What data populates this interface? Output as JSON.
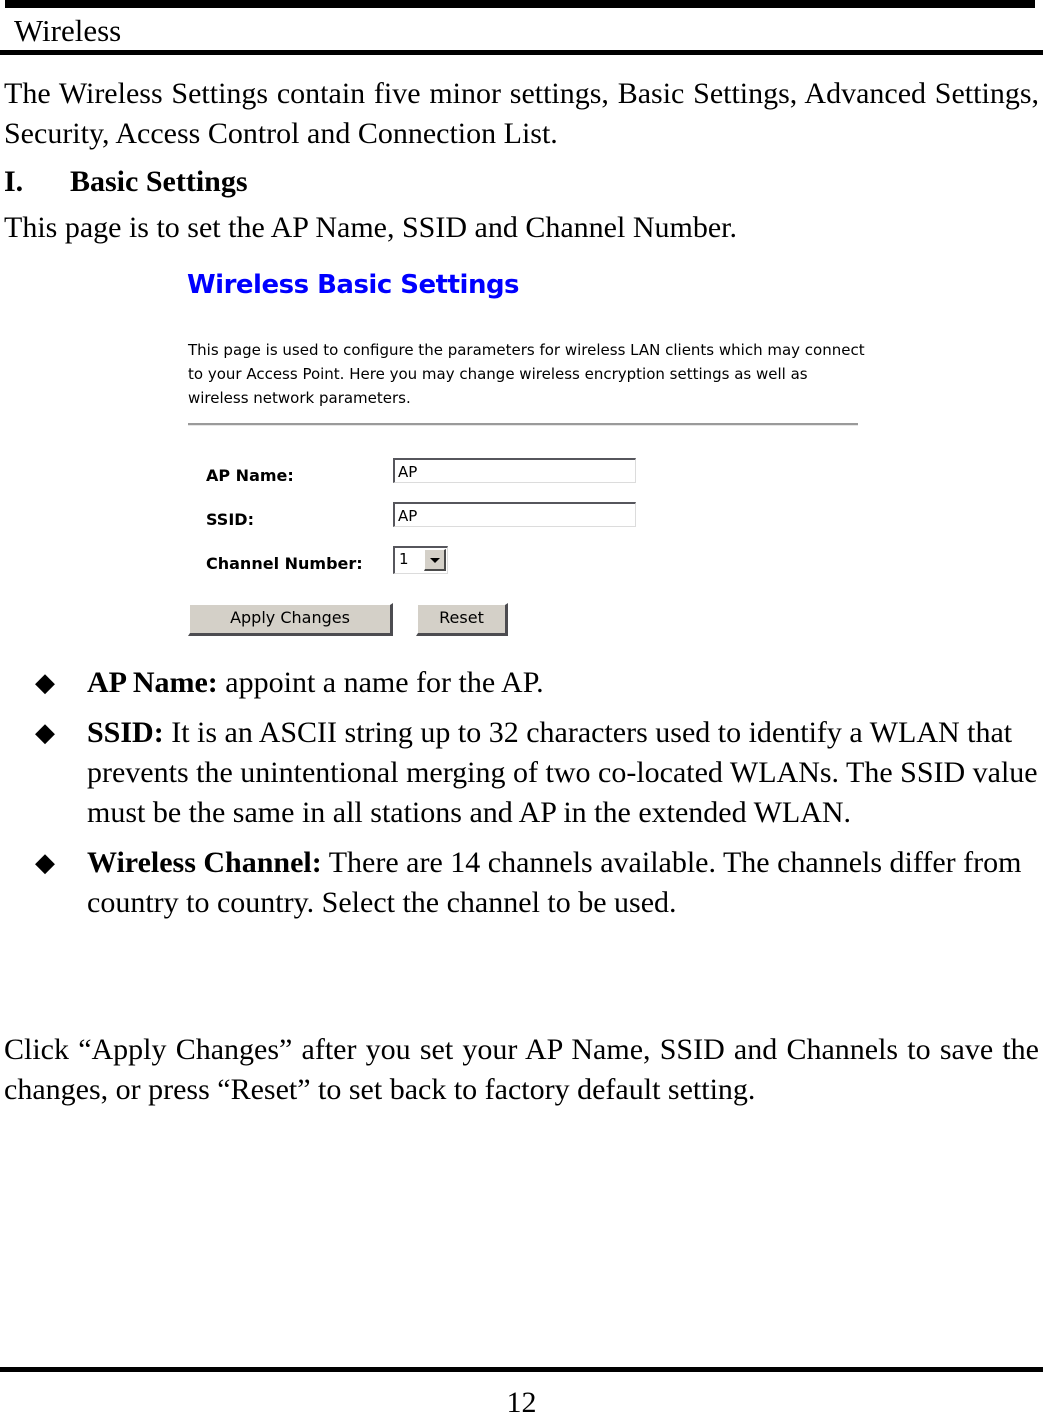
{
  "header": {
    "running_title": "Wireless"
  },
  "body": {
    "intro_paragraph": "The Wireless Settings contain five minor settings, Basic Settings, Advanced Settings, Security, Access Control and Connection List.",
    "section_numeral": "I.",
    "section_title": "Basic Settings",
    "lead_in": "This page is to set the AP Name, SSID and Channel Number."
  },
  "screenshot": {
    "title": "Wireless Basic Settings",
    "description": "This page is used to configure the parameters for wireless LAN clients which may connect to your Access Point. Here you may change wireless encryption settings as well as wireless network parameters.",
    "fields": {
      "ap_name": {
        "label": "AP Name:",
        "value": "AP"
      },
      "ssid": {
        "label": "SSID:",
        "value": "AP"
      },
      "channel_number": {
        "label": "Channel Number:",
        "value": "1"
      }
    },
    "buttons": {
      "apply": "Apply Changes",
      "reset": "Reset"
    },
    "colors": {
      "title_blue": "#0000ff",
      "button_face": "#d4d0c8"
    }
  },
  "bullets": [
    {
      "marker": "◆",
      "term": "AP Name:",
      "description": " appoint a name for the AP."
    },
    {
      "marker": "◆",
      "term": "SSID:",
      "description": " It is an ASCII string up to 32 characters used to identify a WLAN that prevents the unintentional merging of two co-located WLANs. The SSID value must be the same in all stations and AP in the extended WLAN."
    },
    {
      "marker": "◆",
      "term": "Wireless Channel:",
      "description": " There are 14 channels available. The channels differ from country to country. Select the channel to be used."
    }
  ],
  "closing_paragraph": "Click “Apply Changes” after you set your AP Name, SSID and Channels to save the changes, or press “Reset” to set back to factory default setting.",
  "footer": {
    "page_number": "12"
  }
}
